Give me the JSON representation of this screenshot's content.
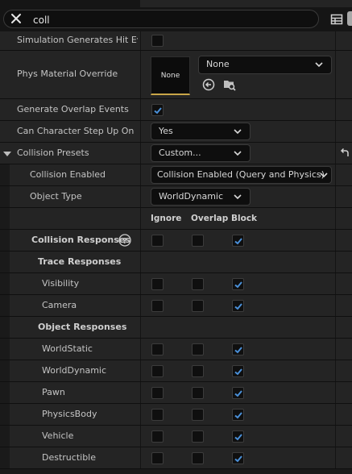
{
  "search": {
    "value": "coll",
    "placeholder": ""
  },
  "rows": {
    "sim_hit": "Simulation Generates Hit Ev...",
    "phys_mat": "Phys Material Override",
    "phys_mat_thumb": "None",
    "phys_mat_value": "None",
    "overlap": "Generate Overlap Events",
    "step_up": "Can Character Step Up On",
    "step_up_value": "Yes",
    "presets": "Collision Presets",
    "presets_value": "Custom...",
    "enabled": "Collision Enabled",
    "enabled_value": "Collision Enabled (Query and Physics)",
    "object_type": "Object Type",
    "object_type_value": "WorldDynamic"
  },
  "columns": {
    "ignore": "Ignore",
    "overlap": "Overlap",
    "block": "Block"
  },
  "responses": {
    "title": "Collision Responses",
    "trace_title": "Trace Responses",
    "object_title": "Object Responses",
    "trace": [
      {
        "label": "Visibility",
        "ignore": false,
        "overlap": false,
        "block": true
      },
      {
        "label": "Camera",
        "ignore": false,
        "overlap": false,
        "block": true
      }
    ],
    "objects": [
      {
        "label": "WorldStatic",
        "ignore": false,
        "overlap": false,
        "block": true
      },
      {
        "label": "WorldDynamic",
        "ignore": false,
        "overlap": false,
        "block": true
      },
      {
        "label": "Pawn",
        "ignore": false,
        "overlap": false,
        "block": true
      },
      {
        "label": "PhysicsBody",
        "ignore": false,
        "overlap": false,
        "block": true
      },
      {
        "label": "Vehicle",
        "ignore": false,
        "overlap": false,
        "block": true
      },
      {
        "label": "Destructible",
        "ignore": false,
        "overlap": false,
        "block": true
      }
    ]
  },
  "colors": {
    "accent": "#4a90d9",
    "thumb_border": "#c9a648",
    "panel": "#242424",
    "background": "#1a1a1a"
  },
  "icons": [
    "close-icon",
    "grid-view-icon",
    "chevron-down-icon",
    "reset-arrow-icon",
    "browse-icon",
    "help-icon",
    "check-icon"
  ]
}
